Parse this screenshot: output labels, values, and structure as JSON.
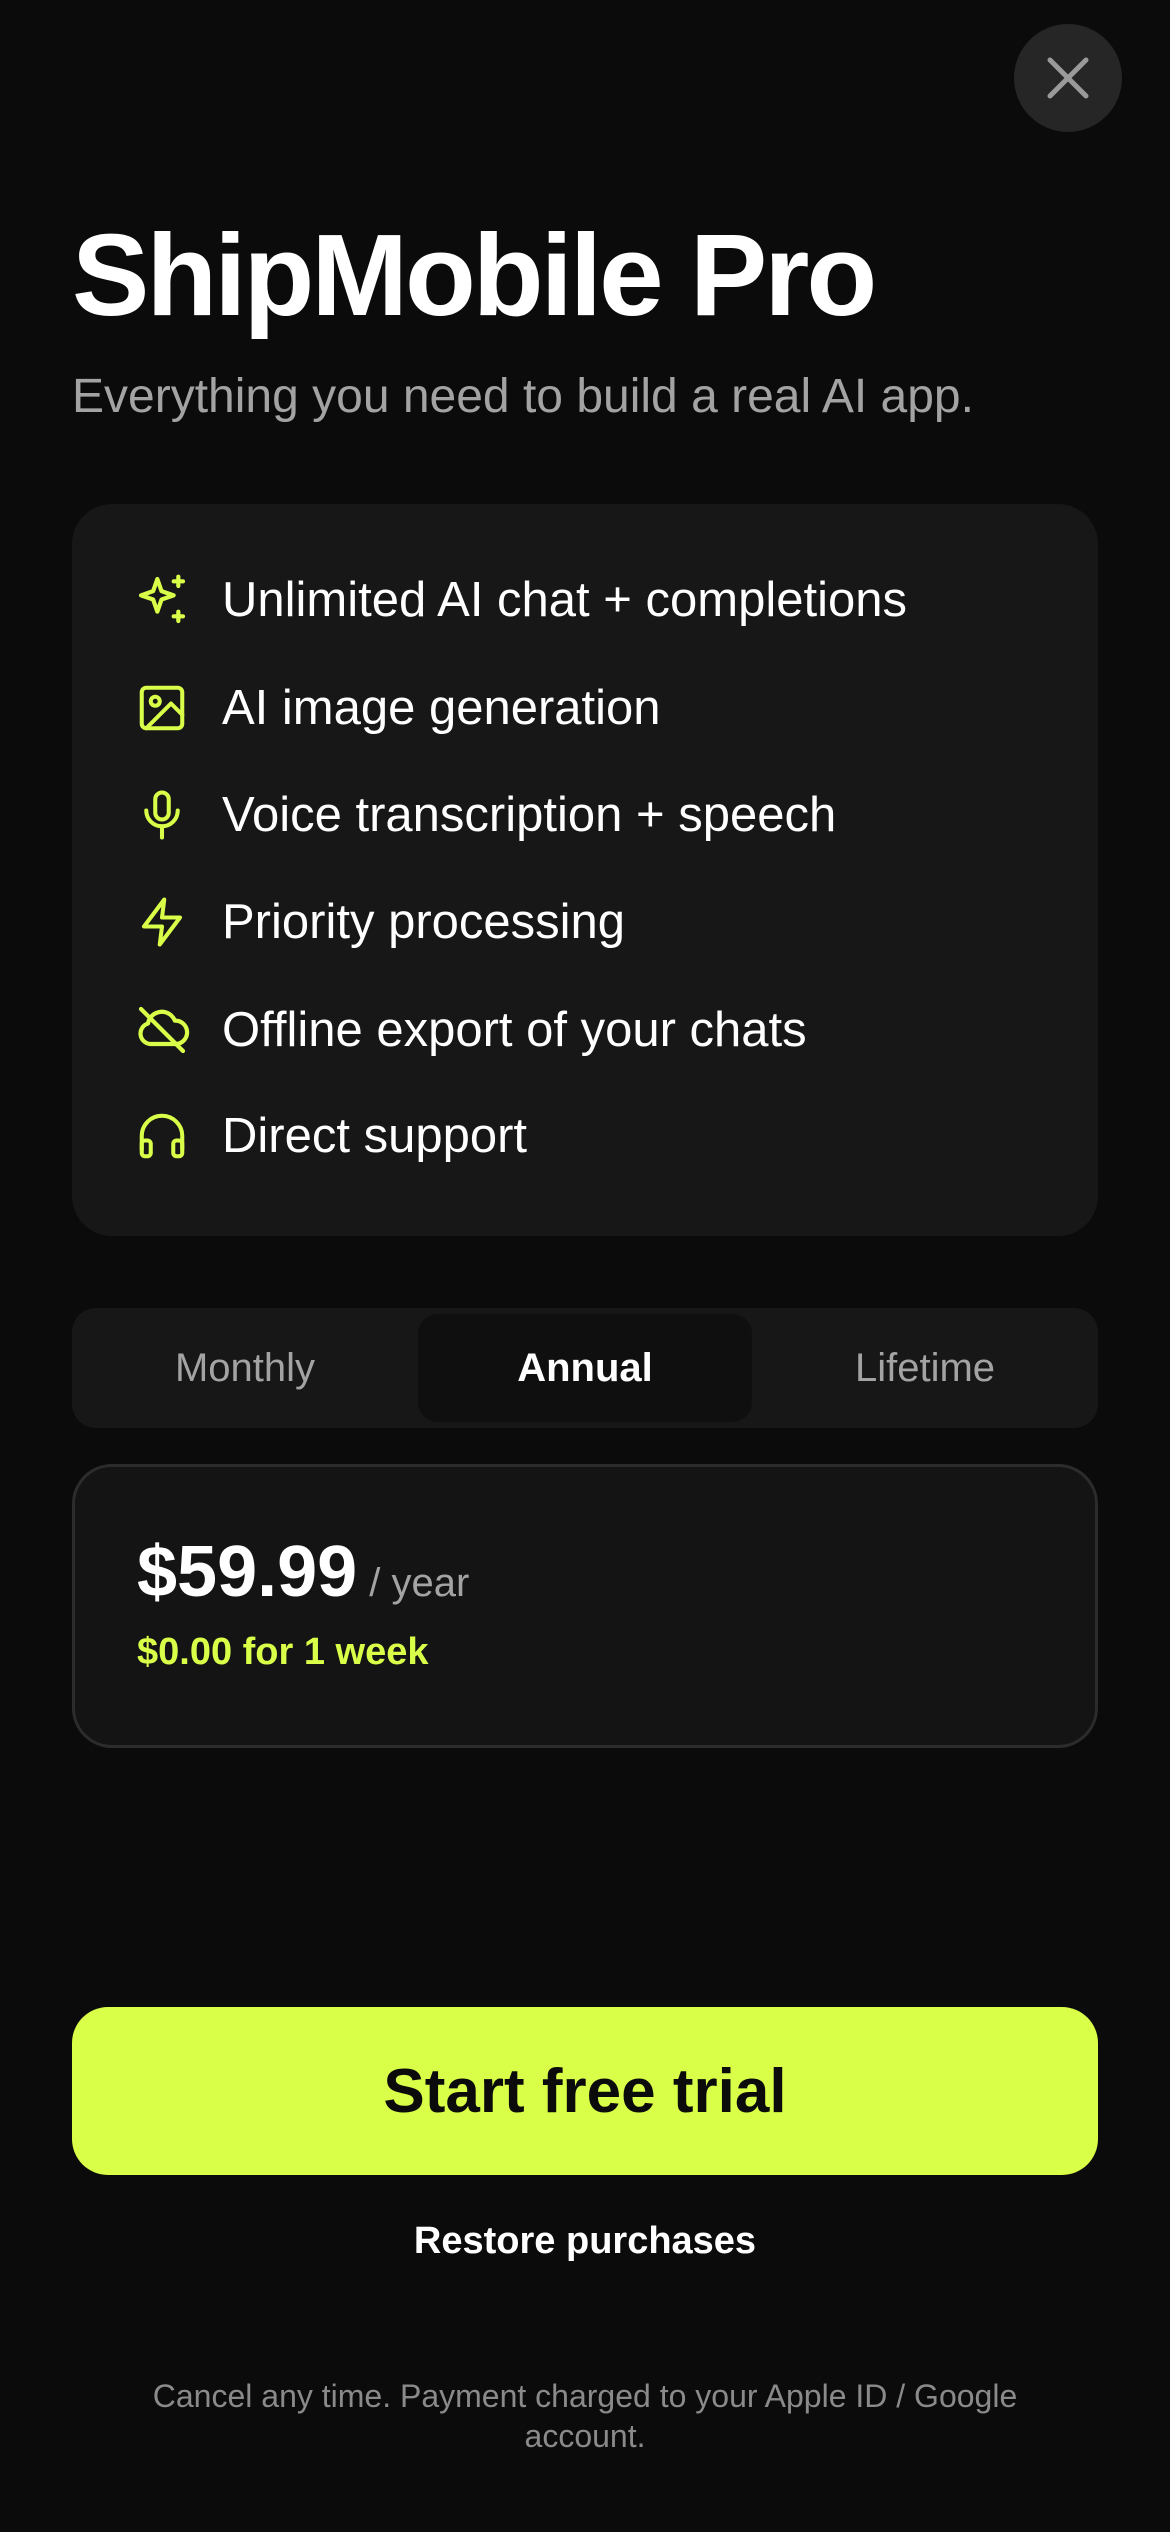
{
  "colors": {
    "background": "#0b0b0b",
    "accent": "#d9ff48",
    "card": "#171717",
    "muted_text": "#a3a3a3"
  },
  "header": {
    "close_icon": "close-icon",
    "title": "ShipMobile Pro",
    "subtitle": "Everything you need to build a real AI app."
  },
  "features": [
    {
      "icon": "sparkles-icon",
      "label": "Unlimited AI chat + completions"
    },
    {
      "icon": "image-icon",
      "label": "AI image generation"
    },
    {
      "icon": "microphone-icon",
      "label": "Voice transcription + speech"
    },
    {
      "icon": "lightning-icon",
      "label": "Priority processing"
    },
    {
      "icon": "cloud-off-icon",
      "label": "Offline export of your chats"
    },
    {
      "icon": "headphones-icon",
      "label": "Direct support"
    }
  ],
  "plans": {
    "options": [
      "Monthly",
      "Annual",
      "Lifetime"
    ],
    "selected": "Annual"
  },
  "price_card": {
    "amount": "$59.99",
    "period": "/ year",
    "trial": "$0.00 for 1 week"
  },
  "cta": {
    "label": "Start free trial"
  },
  "restore": {
    "label": "Restore purchases"
  },
  "legal": {
    "text": "Cancel any time. Payment charged to your Apple ID / Google account."
  }
}
